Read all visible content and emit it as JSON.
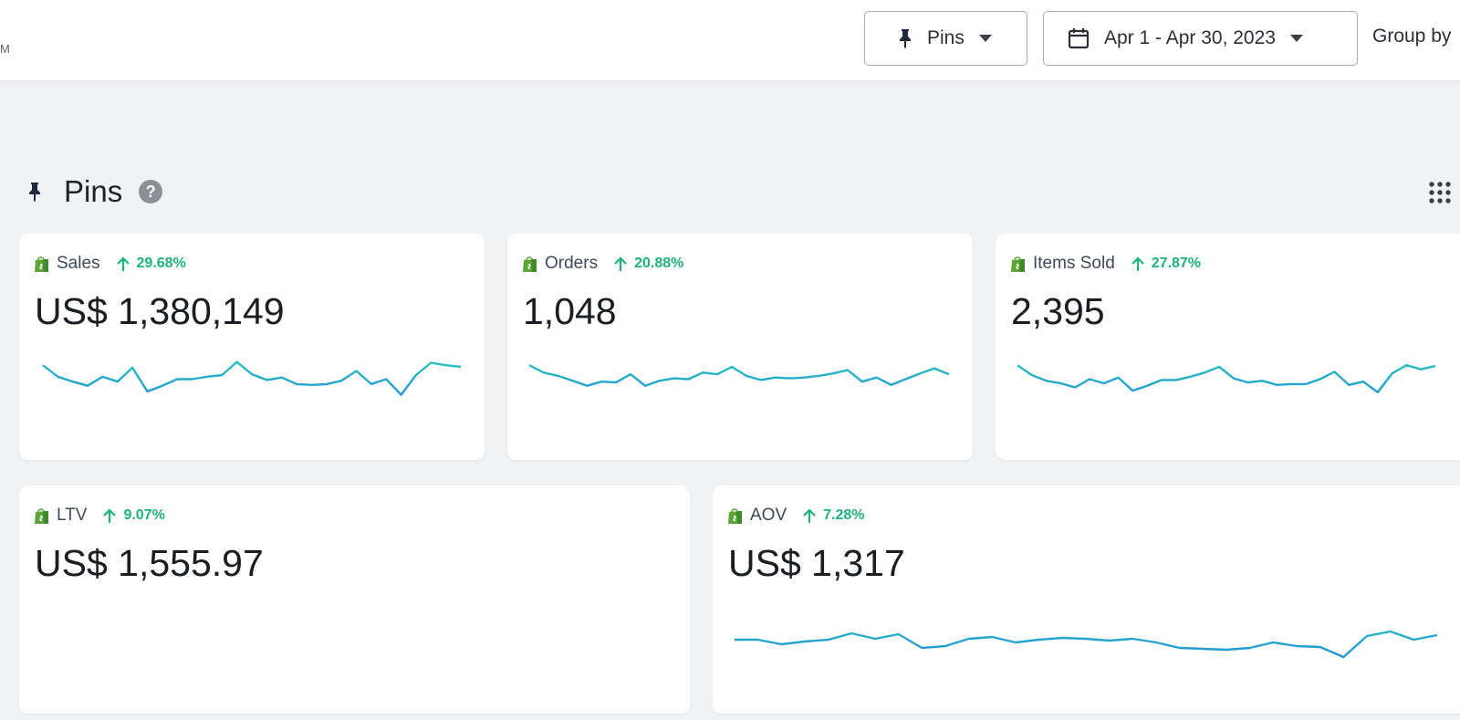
{
  "header": {
    "cut_text": "M",
    "pins_button": {
      "label": "Pins",
      "icon": "pin-icon"
    },
    "date_button": {
      "label": "Apr 1 - Apr 30, 2023",
      "icon": "calendar-icon"
    },
    "group_by_label": "Group by"
  },
  "section": {
    "title": "Pins",
    "help_icon_glyph": "?",
    "icons": [
      "pin-icon",
      "help-icon",
      "grid-icon"
    ]
  },
  "colors": {
    "positive": "#1db37a",
    "spark_start": "#2ee6a6",
    "spark_end": "#1f7be8",
    "shopify_green": "#5ea538"
  },
  "cards": {
    "sales": {
      "label": "Sales",
      "change": "29.68%",
      "value": "US$ 1,380,149",
      "trend": [
        0.38,
        0.52,
        0.58,
        0.63,
        0.52,
        0.58,
        0.41,
        0.7,
        0.63,
        0.55,
        0.55,
        0.52,
        0.5,
        0.34,
        0.49,
        0.56,
        0.53,
        0.61,
        0.62,
        0.61,
        0.57,
        0.45,
        0.61,
        0.55,
        0.74,
        0.5,
        0.35,
        0.38,
        0.4
      ]
    },
    "orders": {
      "label": "Orders",
      "change": "20.88%",
      "value": "1,048",
      "trend": [
        0.38,
        0.47,
        0.51,
        0.57,
        0.63,
        0.58,
        0.59,
        0.49,
        0.63,
        0.57,
        0.54,
        0.55,
        0.47,
        0.49,
        0.4,
        0.51,
        0.56,
        0.53,
        0.54,
        0.53,
        0.51,
        0.48,
        0.44,
        0.58,
        0.53,
        0.62,
        0.55,
        0.48,
        0.42,
        0.49
      ]
    },
    "items_sold": {
      "label": "Items Sold",
      "change": "27.87%",
      "value": "2,395",
      "trend": [
        0.38,
        0.5,
        0.57,
        0.6,
        0.65,
        0.55,
        0.6,
        0.53,
        0.69,
        0.63,
        0.56,
        0.56,
        0.52,
        0.47,
        0.4,
        0.54,
        0.59,
        0.57,
        0.62,
        0.61,
        0.61,
        0.55,
        0.46,
        0.62,
        0.58,
        0.71,
        0.48,
        0.38,
        0.43,
        0.39
      ]
    },
    "ltv": {
      "label": "LTV",
      "change": "9.07%",
      "value": "US$ 1,555.97"
    },
    "aov": {
      "label": "AOV",
      "change": "7.28%",
      "value": "US$ 1,317",
      "trend": [
        0.59,
        0.59,
        0.64,
        0.61,
        0.59,
        0.52,
        0.58,
        0.53,
        0.68,
        0.66,
        0.58,
        0.56,
        0.62,
        0.59,
        0.57,
        0.58,
        0.6,
        0.58,
        0.62,
        0.68,
        0.69,
        0.7,
        0.68,
        0.62,
        0.66,
        0.67,
        0.78,
        0.55,
        0.5,
        0.59,
        0.54
      ]
    }
  }
}
